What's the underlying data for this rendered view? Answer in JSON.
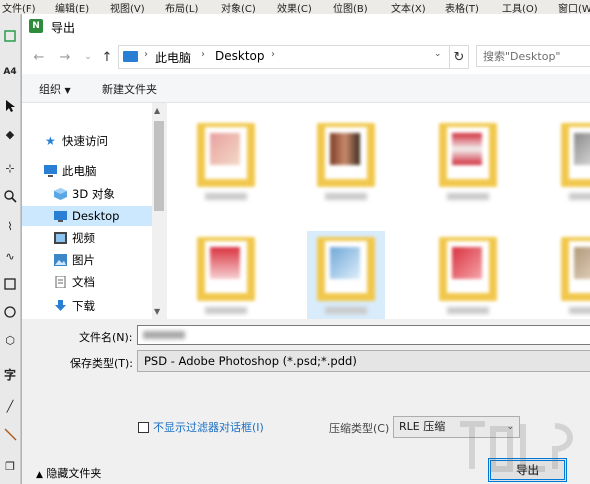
{
  "app_menu": [
    "文件(F)",
    "编辑(E)",
    "视图(V)",
    "布局(L)",
    "对象(C)",
    "效果(C)",
    "位图(B)",
    "文本(X)",
    "表格(T)",
    "工具(O)",
    "窗口(W)"
  ],
  "toolbox": {
    "page_size_label": "A4",
    "text_tool_label": "字"
  },
  "dialog": {
    "title": "导出",
    "breadcrumb": [
      "此电脑",
      "Desktop"
    ],
    "search_placeholder": "搜索\"Desktop\"",
    "commands": {
      "organize": "组织",
      "new_folder": "新建文件夹"
    },
    "nav_items": [
      {
        "label": "快速访问",
        "icon": "star-icon"
      },
      {
        "label": "此电脑",
        "icon": "computer-icon"
      },
      {
        "label": "3D 对象",
        "icon": "cube-icon"
      },
      {
        "label": "Desktop",
        "icon": "desktop-icon",
        "selected": true
      },
      {
        "label": "视频",
        "icon": "video-icon"
      },
      {
        "label": "图片",
        "icon": "picture-icon"
      },
      {
        "label": "文档",
        "icon": "document-icon"
      },
      {
        "label": "下载",
        "icon": "download-icon"
      }
    ],
    "filename_label": "文件名(N):",
    "filetype_label": "保存类型(T):",
    "filetype_value": "PSD - Adobe Photoshop (*.psd;*.pdd)",
    "no_filter_dialog_label": "不显示过滤器对话框(I)",
    "compression_label": "压缩类型(C)",
    "compression_value": "RLE 压缩",
    "hide_folders_label": "隐藏文件夹",
    "export_button": "导出"
  },
  "colors": {
    "accent": "#0078d7",
    "folder": "#f1c84d",
    "selected_bg": "#cce8ff"
  }
}
